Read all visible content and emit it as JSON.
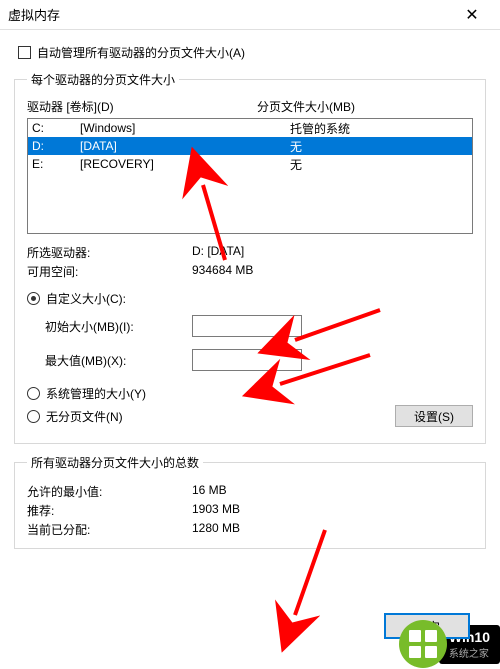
{
  "title": "虚拟内存",
  "auto_manage": "自动管理所有驱动器的分页文件大小(A)",
  "fieldset1": {
    "legend": "每个驱动器的分页文件大小",
    "drive_header_label": "驱动器 [卷标](D)",
    "pagefile_header": "分页文件大小(MB)",
    "drives": [
      {
        "letter": "C:",
        "label": "[Windows]",
        "pagefile": "托管的系统",
        "selected": false
      },
      {
        "letter": "D:",
        "label": "[DATA]",
        "pagefile": "无",
        "selected": true
      },
      {
        "letter": "E:",
        "label": "[RECOVERY]",
        "pagefile": "无",
        "selected": false
      }
    ],
    "selected_drive_label": "所选驱动器:",
    "selected_drive_value": "D:  [DATA]",
    "free_space_label": "可用空间:",
    "free_space_value": "934684 MB",
    "custom_size": "自定义大小(C):",
    "initial_size": "初始大小(MB)(I):",
    "initial_size_value": "",
    "max_size": "最大值(MB)(X):",
    "max_size_value": "",
    "system_managed": "系统管理的大小(Y)",
    "no_pagefile": "无分页文件(N)",
    "set_button": "设置(S)"
  },
  "fieldset2": {
    "legend": "所有驱动器分页文件大小的总数",
    "min_label": "允许的最小值:",
    "min_value": "16 MB",
    "rec_label": "推荐:",
    "rec_value": "1903 MB",
    "cur_label": "当前已分配:",
    "cur_value": "1280 MB"
  },
  "ok_button": "确定",
  "watermark": {
    "line1": "Win10",
    "line2": "系统之家"
  }
}
